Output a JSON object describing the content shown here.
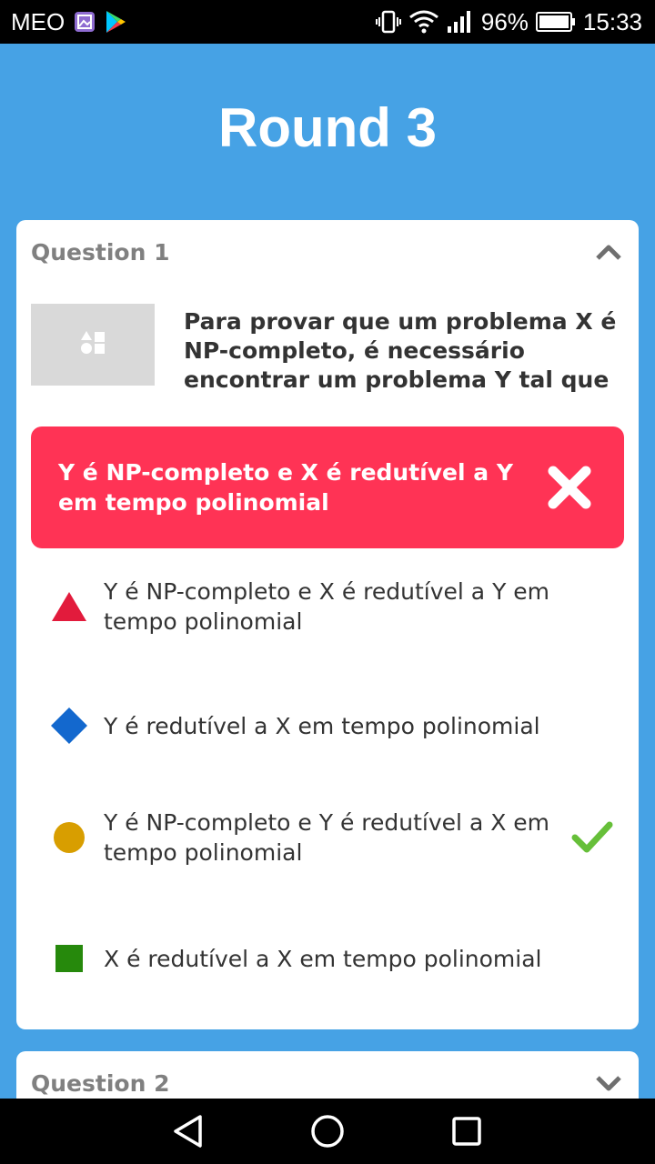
{
  "status_bar": {
    "carrier": "MEO",
    "battery": "96%",
    "time": "15:33"
  },
  "header": {
    "title": "Round 3"
  },
  "question1": {
    "label": "Question 1",
    "text": "Para provar que um problema X é NP-completo, é necessário encontrar um problema Y tal que",
    "given_answer": "Y é NP-completo e X é redutível a Y em tempo polinomial",
    "given_answer_status": "incorrect",
    "options": [
      {
        "shape": "triangle",
        "color": "#E21B3C",
        "text": "Y é NP-completo e X é redutível a Y em tempo polinomial",
        "correct": false
      },
      {
        "shape": "diamond",
        "color": "#1368CE",
        "text": "Y é redutível a X em tempo polinomial",
        "correct": false
      },
      {
        "shape": "circle",
        "color": "#D89E00",
        "text": "Y é NP-completo e Y é redutível a X em tempo polinomial",
        "correct": true
      },
      {
        "shape": "square",
        "color": "#26890C",
        "text": "X é redutível a X em tempo polinomial",
        "correct": false
      }
    ]
  },
  "question2": {
    "label": "Question 2"
  },
  "colors": {
    "background": "#46A2E5",
    "wrong": "#FF3355",
    "correct_check": "#66BF39"
  }
}
